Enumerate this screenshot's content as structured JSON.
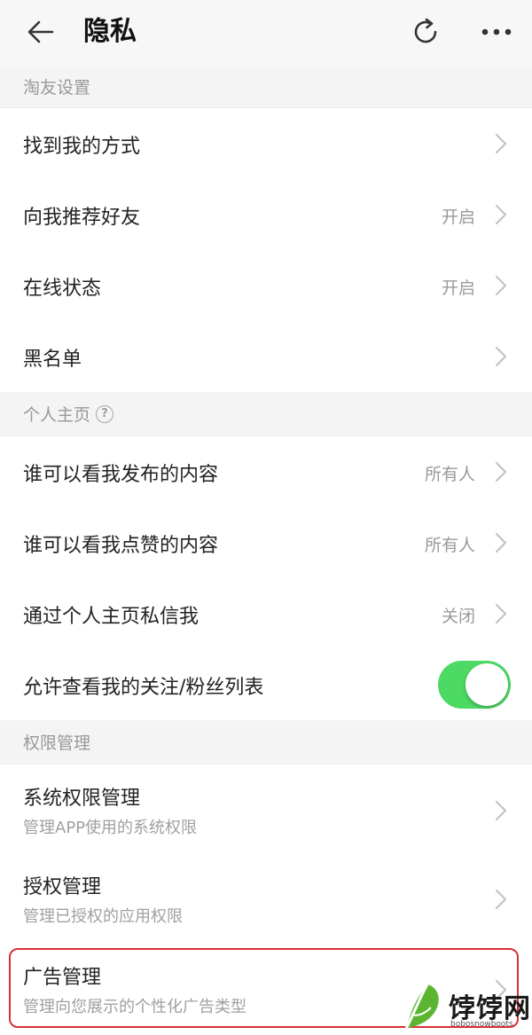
{
  "header": {
    "title": "隐私",
    "back_icon": "arrow-left-icon",
    "refresh_icon": "refresh-icon",
    "more_icon": "more-horizontal-icon"
  },
  "sections": {
    "friends": {
      "label": "淘友设置"
    },
    "homepage": {
      "label": "个人主页"
    },
    "permissions": {
      "label": "权限管理"
    }
  },
  "rows": {
    "find_me": {
      "label": "找到我的方式",
      "value": ""
    },
    "recommend_friends": {
      "label": "向我推荐好友",
      "value": "开启"
    },
    "online_status": {
      "label": "在线状态",
      "value": "开启"
    },
    "blacklist": {
      "label": "黑名单",
      "value": ""
    },
    "see_posts": {
      "label": "谁可以看我发布的内容",
      "value": "所有人"
    },
    "see_likes": {
      "label": "谁可以看我点赞的内容",
      "value": "所有人"
    },
    "message_me": {
      "label": "通过个人主页私信我",
      "value": "关闭"
    },
    "follow_list": {
      "label": "允许查看我的关注/粉丝列表",
      "toggle_on": true
    },
    "system_perm": {
      "label": "系统权限管理",
      "sub": "管理APP使用的系统权限"
    },
    "auth_manage": {
      "label": "授权管理",
      "sub": "管理已授权的应用权限"
    },
    "ad_manage": {
      "label": "广告管理",
      "sub": "管理向您展示的个性化广告类型"
    }
  },
  "watermark": {
    "text": "饽饽网",
    "sub": "bobosnowboots"
  },
  "colors": {
    "toggle_on": "#4cd964",
    "highlight": "#d8303a"
  }
}
